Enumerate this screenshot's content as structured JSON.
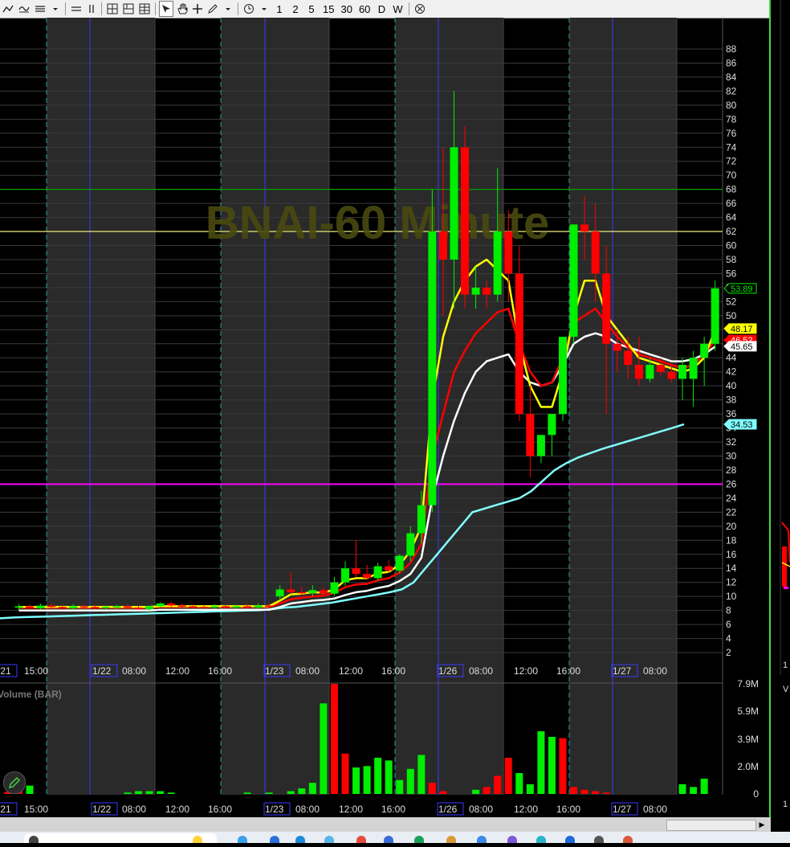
{
  "toolbar": {
    "timeframes": [
      "1",
      "2",
      "5",
      "15",
      "30",
      "60",
      "D",
      "W"
    ]
  },
  "chart": {
    "watermark": "BNAI-60 Minute",
    "volume_label": "Volume (BAR)",
    "price_axis_ticks": [
      "88",
      "86",
      "84",
      "82",
      "80",
      "78",
      "76",
      "74",
      "72",
      "70",
      "68",
      "66",
      "64",
      "62",
      "60",
      "58",
      "56",
      "54",
      "52",
      "50",
      "48",
      "46",
      "44",
      "42",
      "40",
      "38",
      "36",
      "34",
      "32",
      "30",
      "28",
      "26",
      "24",
      "22",
      "20",
      "18",
      "16",
      "14",
      "12",
      "10",
      "8",
      "6",
      "4",
      "2"
    ],
    "volume_axis_ticks": [
      "7.9M",
      "5.9M",
      "3.9M",
      "2.0M",
      "0"
    ],
    "time_axis_labels": [
      "/21",
      "15:00",
      "1/22",
      "08:00",
      "12:00",
      "16:00",
      "1/23",
      "08:00",
      "12:00",
      "16:00",
      "1/26",
      "08:00",
      "12:00",
      "16:00",
      "1/27",
      "08:00"
    ],
    "price_tags": [
      "53.89",
      "48.17",
      "46.52",
      "45.65",
      "34.53"
    ],
    "colors": {
      "up": "#00ee00",
      "down": "#ff0000",
      "ema_fast": "#ffff00",
      "ema_mid": "#ff0000",
      "ema_slow": "#ffffff",
      "ma_long": "#80ffff",
      "line_68": "#00a000",
      "line_62": "#d8d870",
      "line_26": "#ff00ff",
      "session_shade": "#2a2a2a"
    },
    "horizontal_levels": [
      68,
      62,
      26
    ],
    "right_strip_labels": [
      "1",
      "V",
      "1"
    ]
  },
  "chart_data": {
    "type": "candlestick",
    "title": "BNAI-60 Minute",
    "ylim": [
      0,
      90
    ],
    "candles": [
      {
        "o": 8.4,
        "h": 8.9,
        "l": 8.0,
        "c": 8.6
      },
      {
        "o": 8.6,
        "h": 8.9,
        "l": 8.1,
        "c": 8.3
      },
      {
        "o": 8.3,
        "h": 9.0,
        "l": 8.1,
        "c": 8.7
      },
      {
        "o": 8.7,
        "h": 9.0,
        "l": 8.3,
        "c": 8.5
      },
      {
        "o": 8.5,
        "h": 8.8,
        "l": 8.1,
        "c": 8.3
      },
      {
        "o": 8.3,
        "h": 8.9,
        "l": 8.1,
        "c": 8.6
      },
      {
        "o": 8.6,
        "h": 8.9,
        "l": 8.2,
        "c": 8.5
      },
      {
        "o": 8.5,
        "h": 8.8,
        "l": 8.2,
        "c": 8.4
      },
      {
        "o": 8.4,
        "h": 8.7,
        "l": 8.1,
        "c": 8.5
      },
      {
        "o": 8.5,
        "h": 8.8,
        "l": 8.2,
        "c": 8.6
      },
      {
        "o": 8.6,
        "h": 8.9,
        "l": 8.3,
        "c": 8.4
      },
      {
        "o": 8.4,
        "h": 8.7,
        "l": 8.1,
        "c": 8.2
      },
      {
        "o": 8.2,
        "h": 8.7,
        "l": 8.0,
        "c": 8.6
      },
      {
        "o": 8.6,
        "h": 9.2,
        "l": 8.4,
        "c": 9.0
      },
      {
        "o": 9.0,
        "h": 9.3,
        "l": 8.5,
        "c": 8.7
      },
      {
        "o": 8.7,
        "h": 9.0,
        "l": 8.4,
        "c": 8.6
      },
      {
        "o": 8.6,
        "h": 8.9,
        "l": 8.3,
        "c": 8.5
      },
      {
        "o": 8.5,
        "h": 8.8,
        "l": 8.2,
        "c": 8.4
      },
      {
        "o": 8.4,
        "h": 8.9,
        "l": 8.2,
        "c": 8.6
      },
      {
        "o": 8.6,
        "h": 8.8,
        "l": 8.3,
        "c": 8.4
      },
      {
        "o": 8.4,
        "h": 8.8,
        "l": 8.2,
        "c": 8.6
      },
      {
        "o": 8.6,
        "h": 8.9,
        "l": 8.3,
        "c": 8.4
      },
      {
        "o": 8.4,
        "h": 9.0,
        "l": 8.2,
        "c": 8.7
      },
      {
        "o": 8.7,
        "h": 9.0,
        "l": 8.4,
        "c": 8.6
      },
      {
        "o": 10.0,
        "h": 11.6,
        "l": 9.4,
        "c": 11.0
      },
      {
        "o": 11.0,
        "h": 13.5,
        "l": 10.3,
        "c": 10.6
      },
      {
        "o": 10.6,
        "h": 11.4,
        "l": 10.1,
        "c": 10.5
      },
      {
        "o": 10.5,
        "h": 11.6,
        "l": 10.0,
        "c": 10.9
      },
      {
        "o": 10.9,
        "h": 11.3,
        "l": 10.2,
        "c": 10.4
      },
      {
        "o": 10.4,
        "h": 12.8,
        "l": 10.1,
        "c": 12.0
      },
      {
        "o": 12.0,
        "h": 15.0,
        "l": 11.5,
        "c": 14.0
      },
      {
        "o": 14.0,
        "h": 18.0,
        "l": 12.8,
        "c": 13.2
      },
      {
        "o": 13.2,
        "h": 14.5,
        "l": 12.5,
        "c": 12.6
      },
      {
        "o": 12.6,
        "h": 14.8,
        "l": 12.2,
        "c": 14.3
      },
      {
        "o": 14.3,
        "h": 15.2,
        "l": 13.4,
        "c": 13.7
      },
      {
        "o": 13.7,
        "h": 16.0,
        "l": 13.3,
        "c": 15.8
      },
      {
        "o": 15.8,
        "h": 20.0,
        "l": 15.0,
        "c": 19.0
      },
      {
        "o": 19.0,
        "h": 25.0,
        "l": 17.5,
        "c": 23.0
      },
      {
        "o": 23.0,
        "h": 68.0,
        "l": 22.0,
        "c": 62.0
      },
      {
        "o": 62.0,
        "h": 74.0,
        "l": 50.0,
        "c": 58.0
      },
      {
        "o": 58.0,
        "h": 82.0,
        "l": 51.0,
        "c": 74.0
      },
      {
        "o": 74.0,
        "h": 77.0,
        "l": 51.0,
        "c": 53.0
      },
      {
        "o": 53.0,
        "h": 57.0,
        "l": 51.0,
        "c": 54.0
      },
      {
        "o": 54.0,
        "h": 55.0,
        "l": 51.0,
        "c": 53.0
      },
      {
        "o": 53.0,
        "h": 71.0,
        "l": 52.0,
        "c": 62.0
      },
      {
        "o": 62.0,
        "h": 65.0,
        "l": 52.0,
        "c": 56.0
      },
      {
        "o": 56.0,
        "h": 60.0,
        "l": 35.0,
        "c": 36.0
      },
      {
        "o": 36.0,
        "h": 40.0,
        "l": 27.0,
        "c": 30.0
      },
      {
        "o": 30.0,
        "h": 33.0,
        "l": 29.0,
        "c": 33.0
      },
      {
        "o": 33.0,
        "h": 36.0,
        "l": 30.0,
        "c": 36.0
      },
      {
        "o": 36.0,
        "h": 47.0,
        "l": 35.0,
        "c": 47.0
      },
      {
        "o": 47.0,
        "h": 63.0,
        "l": 46.0,
        "c": 63.0
      },
      {
        "o": 63.0,
        "h": 67.0,
        "l": 58.0,
        "c": 62.0
      },
      {
        "o": 62.0,
        "h": 66.0,
        "l": 52.0,
        "c": 56.0
      },
      {
        "o": 56.0,
        "h": 60.0,
        "l": 36.0,
        "c": 46.0
      },
      {
        "o": 46.0,
        "h": 48.0,
        "l": 42.0,
        "c": 45.0
      },
      {
        "o": 45.0,
        "h": 47.0,
        "l": 41.0,
        "c": 43.0
      },
      {
        "o": 43.0,
        "h": 47.0,
        "l": 40.0,
        "c": 41.0
      },
      {
        "o": 41.0,
        "h": 44.0,
        "l": 40.5,
        "c": 43.0
      },
      {
        "o": 43.0,
        "h": 44.0,
        "l": 41.5,
        "c": 42.0
      },
      {
        "o": 42.0,
        "h": 43.0,
        "l": 40.5,
        "c": 41.0
      },
      {
        "o": 41.0,
        "h": 44.0,
        "l": 38.0,
        "c": 43.0
      },
      {
        "o": 41.0,
        "h": 45.0,
        "l": 37.0,
        "c": 44.0
      },
      {
        "o": 44.0,
        "h": 47.0,
        "l": 40.0,
        "c": 46.0
      },
      {
        "o": 46.0,
        "h": 55.0,
        "l": 45.0,
        "c": 53.9
      }
    ],
    "ema_fast": [
      8.5,
      8.5,
      8.5,
      8.5,
      8.5,
      8.5,
      8.5,
      8.5,
      8.5,
      8.5,
      8.5,
      8.5,
      8.5,
      8.6,
      8.6,
      8.6,
      8.6,
      8.6,
      8.6,
      8.6,
      8.6,
      8.6,
      8.6,
      8.6,
      9.4,
      10.3,
      10.4,
      10.6,
      10.5,
      11.0,
      12.3,
      12.6,
      12.6,
      13.3,
      13.5,
      14.5,
      16.5,
      20.0,
      38.0,
      47.0,
      52.0,
      55.0,
      57.0,
      58.0,
      56.5,
      55.0,
      46.0,
      40.0,
      37.0,
      37.0,
      42.0,
      50.0,
      55.0,
      55.0,
      50.0,
      48.0,
      46.0,
      44.0,
      43.5,
      43.0,
      42.5,
      42.0,
      42.5,
      44.0,
      48.0
    ],
    "ema_mid": [
      8.4,
      8.4,
      8.4,
      8.4,
      8.4,
      8.4,
      8.4,
      8.4,
      8.4,
      8.4,
      8.4,
      8.4,
      8.4,
      8.5,
      8.5,
      8.5,
      8.5,
      8.5,
      8.5,
      8.5,
      8.5,
      8.5,
      8.5,
      8.5,
      9.0,
      9.6,
      9.8,
      10.0,
      10.1,
      10.5,
      11.3,
      11.7,
      11.8,
      12.3,
      12.6,
      13.4,
      14.8,
      17.5,
      30.0,
      36.0,
      42.0,
      45.0,
      47.5,
      49.0,
      50.5,
      51.0,
      46.0,
      42.0,
      40.0,
      40.5,
      44.0,
      49.0,
      50.0,
      51.0,
      49.0,
      47.0,
      45.5,
      44.5,
      44.0,
      43.5,
      43.0,
      42.5,
      43.0,
      44.5,
      46.5
    ],
    "ema_slow": [
      8.0,
      8.0,
      8.0,
      8.0,
      8.0,
      8.0,
      8.0,
      8.0,
      8.0,
      8.0,
      8.0,
      8.0,
      8.0,
      8.1,
      8.1,
      8.1,
      8.1,
      8.1,
      8.1,
      8.1,
      8.1,
      8.1,
      8.1,
      8.1,
      8.5,
      9.0,
      9.2,
      9.4,
      9.5,
      9.7,
      10.2,
      10.6,
      10.8,
      11.2,
      11.5,
      12.2,
      13.2,
      15.5,
      24.0,
      30.0,
      35.0,
      39.0,
      42.0,
      43.5,
      44.0,
      44.5,
      42.0,
      40.5,
      40.0,
      40.5,
      43.0,
      46.0,
      47.0,
      47.5,
      47.0,
      46.0,
      45.5,
      45.0,
      44.5,
      44.0,
      43.5,
      43.5,
      43.8,
      44.5,
      45.6
    ],
    "ma_long": [
      6.8,
      6.9,
      7.0,
      7.05,
      7.1,
      7.15,
      7.2,
      7.25,
      7.3,
      7.35,
      7.4,
      7.45,
      7.5,
      7.55,
      7.6,
      7.65,
      7.7,
      7.75,
      7.8,
      7.85,
      7.9,
      7.95,
      8.0,
      8.05,
      8.2,
      8.4,
      8.5,
      8.7,
      8.9,
      9.1,
      9.4,
      9.7,
      10.0,
      10.3,
      10.6,
      11.0,
      12.0,
      14.0,
      16.0,
      18.0,
      20.0,
      22.0,
      22.5,
      23.0,
      23.5,
      24.0,
      25.0,
      26.5,
      28.0,
      29.0,
      29.8,
      30.4,
      31.0,
      31.5,
      32.0,
      32.5,
      33.0,
      33.5,
      34.0,
      34.53
    ],
    "volume_axis_max": 7.9,
    "volume_M": [
      0.15,
      1.2,
      0.6,
      0.0,
      0.0,
      0.0,
      0.0,
      0.0,
      0.0,
      0.0,
      0.0,
      0.1,
      0.2,
      0.2,
      0.2,
      0.1,
      0.0,
      0.0,
      0.0,
      0.0,
      0.0,
      0.0,
      0.1,
      0.0,
      0.1,
      0.0,
      0.2,
      0.4,
      0.8,
      6.5,
      7.9,
      2.9,
      1.9,
      2.0,
      2.6,
      2.4,
      1.0,
      1.8,
      2.8,
      0.8,
      0.2,
      0.0,
      0.0,
      0.3,
      0.5,
      1.3,
      2.6,
      1.5,
      0.7,
      4.5,
      4.1,
      4.0,
      0.5,
      0.3,
      0.2,
      0.1,
      0.0,
      0.0,
      0.0,
      0.0,
      0.0,
      0.0,
      0.7,
      0.5,
      1.1
    ],
    "volume_up": [
      0,
      0,
      1,
      1,
      1,
      1,
      1,
      1,
      1,
      1,
      1,
      1,
      1,
      1,
      1,
      1,
      1,
      1,
      1,
      1,
      1,
      1,
      1,
      1,
      1,
      0,
      1,
      1,
      1,
      1,
      0,
      0,
      1,
      1,
      1,
      1,
      1,
      1,
      1,
      0,
      0,
      0,
      0,
      1,
      0,
      0,
      0,
      1,
      1,
      1,
      1,
      0,
      0,
      0,
      0,
      0,
      0,
      0,
      0,
      0,
      0,
      0,
      1,
      1,
      1
    ]
  }
}
